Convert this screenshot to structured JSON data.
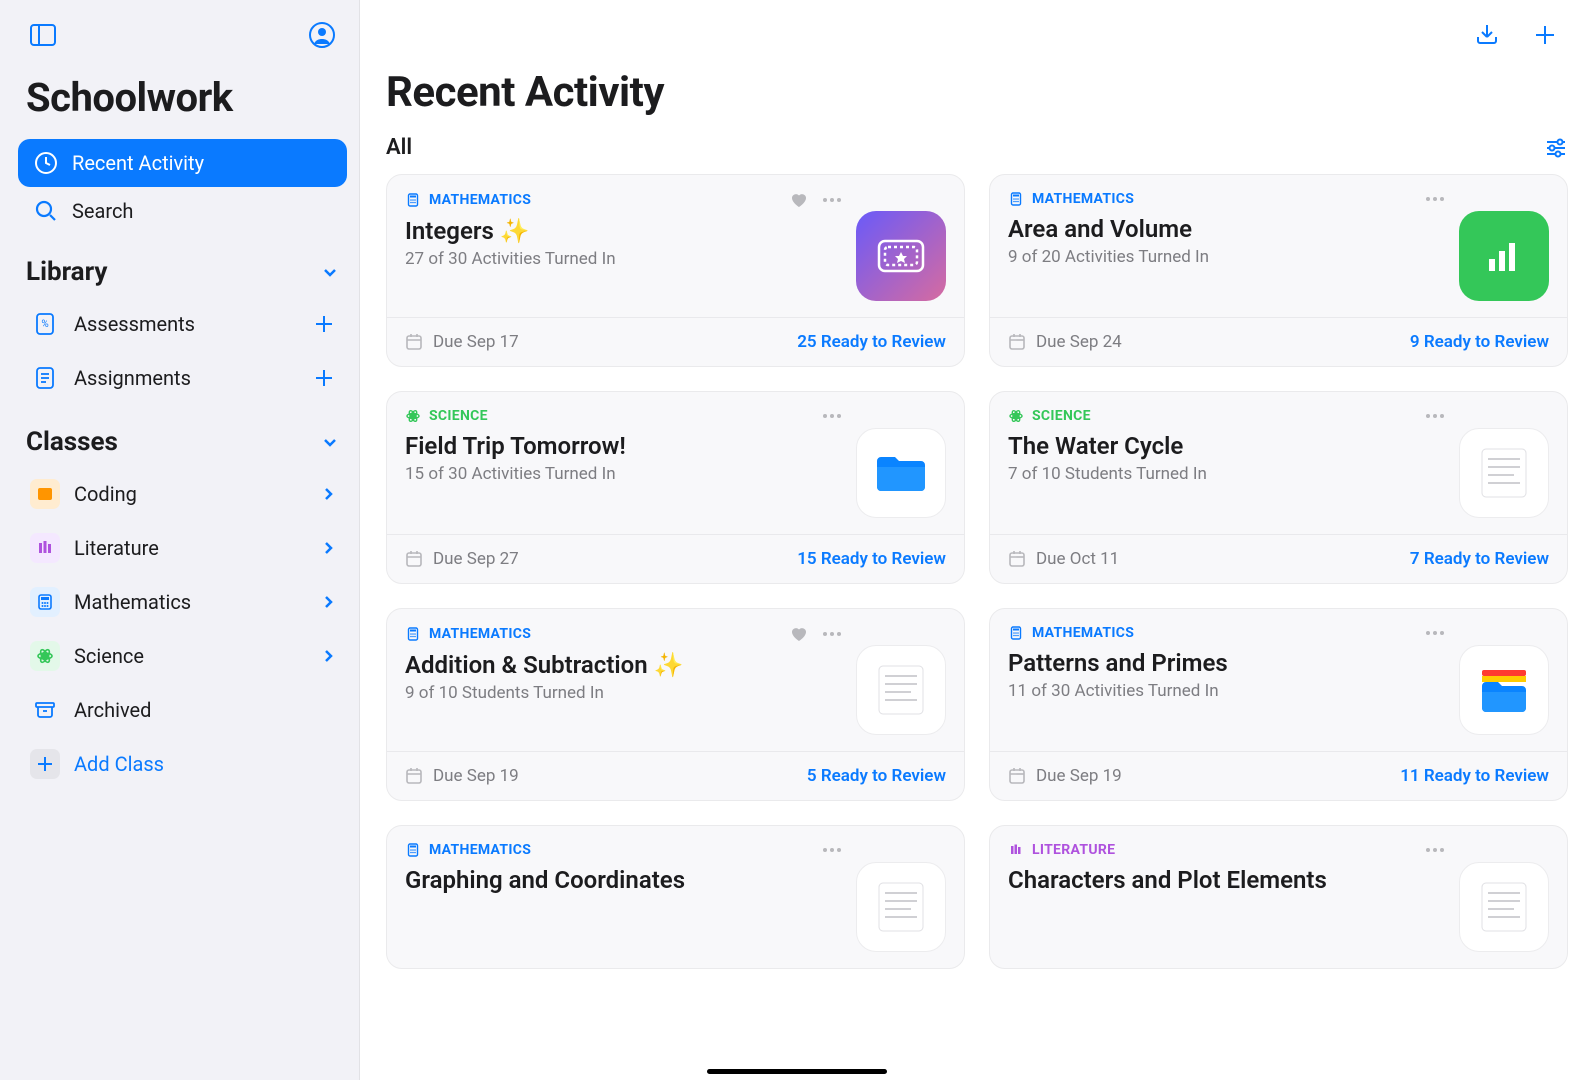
{
  "app": {
    "title": "Schoolwork"
  },
  "sidebar": {
    "nav": {
      "recent": "Recent Activity",
      "search": "Search"
    },
    "library": {
      "header": "Library",
      "assessments": "Assessments",
      "assignments": "Assignments"
    },
    "classes": {
      "header": "Classes",
      "items": [
        {
          "label": "Coding"
        },
        {
          "label": "Literature"
        },
        {
          "label": "Mathematics"
        },
        {
          "label": "Science"
        }
      ],
      "archived": "Archived",
      "add": "Add Class"
    }
  },
  "main": {
    "title": "Recent Activity",
    "filter": "All"
  },
  "cards": [
    {
      "subject": "MATHEMATICS",
      "subjectClass": "subj-math",
      "title": "Integers ✨",
      "sub": "27 of 30 Activities Turned In",
      "due": "Due Sep 17",
      "ready": "25 Ready to Review",
      "favorite": true,
      "thumbStyle": "gradient-ticket"
    },
    {
      "subject": "MATHEMATICS",
      "subjectClass": "subj-math",
      "title": "Area and Volume",
      "sub": "9 of 20 Activities Turned In",
      "due": "Due Sep 24",
      "ready": "9 Ready to Review",
      "favorite": false,
      "thumbStyle": "green-chart"
    },
    {
      "subject": "SCIENCE",
      "subjectClass": "subj-science",
      "title": "Field Trip Tomorrow!",
      "sub": "15 of 30 Activities Turned In",
      "due": "Due Sep 27",
      "ready": "15 Ready to Review",
      "favorite": false,
      "thumbStyle": "blue-folder"
    },
    {
      "subject": "SCIENCE",
      "subjectClass": "subj-science",
      "title": "The Water Cycle",
      "sub": "7 of 10 Students Turned In",
      "due": "Due Oct 11",
      "ready": "7 Ready to Review",
      "favorite": false,
      "thumbStyle": "doc"
    },
    {
      "subject": "MATHEMATICS",
      "subjectClass": "subj-math",
      "title": "Addition & Subtraction ✨",
      "sub": "9 of 10 Students Turned In",
      "due": "Due Sep 19",
      "ready": "5 Ready to Review",
      "favorite": true,
      "thumbStyle": "doc"
    },
    {
      "subject": "MATHEMATICS",
      "subjectClass": "subj-math",
      "title": "Patterns and Primes",
      "sub": "11 of 30 Activities Turned In",
      "due": "Due Sep 19",
      "ready": "11 Ready to Review",
      "favorite": false,
      "thumbStyle": "colorful-folder"
    },
    {
      "subject": "MATHEMATICS",
      "subjectClass": "subj-math",
      "title": "Graphing and Coordinates",
      "sub": "",
      "due": "",
      "ready": "",
      "favorite": false,
      "thumbStyle": "doc"
    },
    {
      "subject": "LITERATURE",
      "subjectClass": "subj-literature",
      "title": "Characters and Plot Elements",
      "sub": "",
      "due": "",
      "ready": "",
      "favorite": false,
      "thumbStyle": "doc"
    }
  ]
}
